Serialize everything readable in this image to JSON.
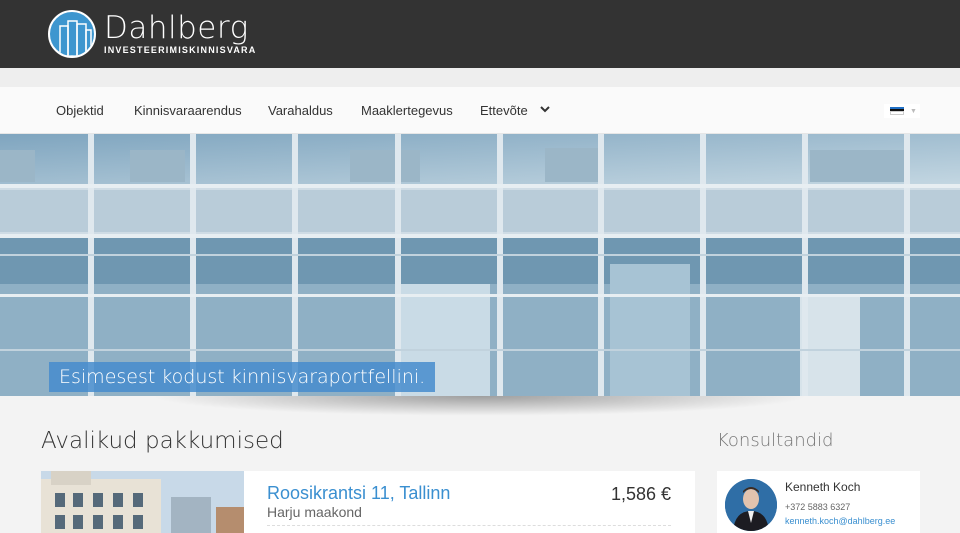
{
  "brand": {
    "name": "Dahlberg",
    "tagline": "INVESTEERIMISKINNISVARA",
    "accent_color": "#3d96cf",
    "logo_icon": "buildings-circle-logo"
  },
  "nav": {
    "items": [
      {
        "label": "Objektid"
      },
      {
        "label": "Kinnisvaraarendus"
      },
      {
        "label": "Varahaldus"
      },
      {
        "label": "Maaklertegevus"
      },
      {
        "label": "Ettevõte"
      }
    ],
    "dropdown_icon": "chevron-down-icon",
    "language_flag": "estonian-flag-icon"
  },
  "hero": {
    "caption": "Esimesest kodust kinnisvaraportfellini."
  },
  "offers": {
    "title": "Avalikud pakkumised",
    "items": [
      {
        "title": "Roosikrantsi 11, Tallinn",
        "county": "Harju maakond",
        "price": "1,586 €"
      }
    ]
  },
  "consultants": {
    "title": "Konsultandid",
    "items": [
      {
        "name": "Kenneth Koch",
        "phone": "+372 5883 6327",
        "email": "kenneth.koch@dahlberg.ee"
      }
    ]
  }
}
